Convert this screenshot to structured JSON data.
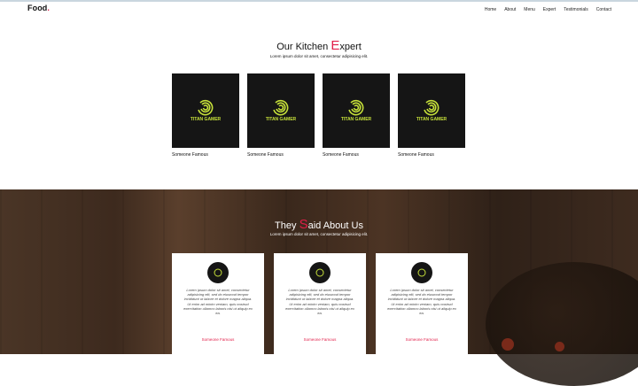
{
  "nav": {
    "logo": "Food",
    "logo_dot": ".",
    "items": [
      "Home",
      "About",
      "Menu",
      "Expert",
      "Testimonials",
      "Contact"
    ]
  },
  "experts": {
    "title_prefix": "Our Kitchen ",
    "title_cap": "E",
    "title_rest": "xpert",
    "subtitle": "Lorem ipsum dolor sit amet, consectetur adipisicing elit.",
    "brand_text": "TITAN GAMER",
    "cards": [
      {
        "name": "Someone Famous"
      },
      {
        "name": "Someone Famous"
      },
      {
        "name": "Someone Famous"
      },
      {
        "name": "Someone Famous"
      }
    ]
  },
  "testimonials": {
    "title_prefix": "They ",
    "title_cap": "S",
    "title_rest": "aid About Us",
    "subtitle": "Lorem ipsum dolor sit amet, consectetur adipisicing elit.",
    "cards": [
      {
        "quote": "Lorem ipsum dolor sit amet, consectetur adipisicing elit, sed do eiusmod tempor incididunt ut labore et dolore magna aliqua. Ut enim ad minim veniam, quis nostrud exercitation ullamco laboris nisi ut aliquip ex ea.",
        "author": "Someone Famous"
      },
      {
        "quote": "Lorem ipsum dolor sit amet, consectetur adipisicing elit, sed do eiusmod tempor incididunt ut labore et dolore magna aliqua. Ut enim ad minim veniam, quis nostrud exercitation ullamco laboris nisi ut aliquip ex ea.",
        "author": "Someone Famous"
      },
      {
        "quote": "Lorem ipsum dolor sit amet, consectetur adipisicing elit, sed do eiusmod tempor incididunt ut labore et dolore magna aliqua. Ut enim ad minim veniam, quis nostrud exercitation ullamco laboris nisi ut aliquip ex ea.",
        "author": "Someone Famous"
      }
    ]
  },
  "colors": {
    "accent": "#e11d48",
    "card_dark": "#151515",
    "logo_green": "#c6e03a"
  }
}
